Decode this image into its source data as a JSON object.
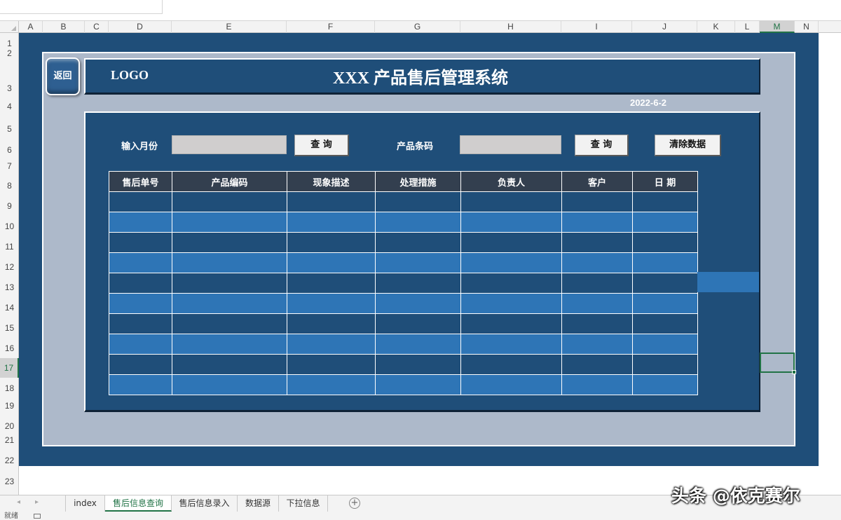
{
  "columns": [
    "A",
    "B",
    "C",
    "D",
    "E",
    "F",
    "G",
    "H",
    "I",
    "J",
    "K",
    "L",
    "M",
    "N"
  ],
  "selected_column": "M",
  "rows": [
    "1",
    "2",
    "3",
    "4",
    "5",
    "6",
    "7",
    "8",
    "9",
    "10",
    "11",
    "12",
    "13",
    "14",
    "15",
    "16",
    "17",
    "18",
    "19",
    "20",
    "21",
    "22",
    "23"
  ],
  "selected_row": "17",
  "dashboard": {
    "back_button": "返回",
    "logo": "LOGO",
    "title": "XXX 产品售后管理系统",
    "date": "2022-6-2"
  },
  "query": {
    "month_label": "输入月份",
    "month_value": "",
    "month_query_button": "查 询",
    "barcode_label": "产品条码",
    "barcode_value": "",
    "barcode_query_button": "查 询",
    "clear_button": "清除数据"
  },
  "table": {
    "headers": [
      "售后单号",
      "产品编码",
      "现象描述",
      "处理措施",
      "负责人",
      "客户",
      "日 期"
    ],
    "rows": [
      [
        "",
        "",
        "",
        "",
        "",
        "",
        ""
      ],
      [
        "",
        "",
        "",
        "",
        "",
        "",
        ""
      ],
      [
        "",
        "",
        "",
        "",
        "",
        "",
        ""
      ],
      [
        "",
        "",
        "",
        "",
        "",
        "",
        ""
      ],
      [
        "",
        "",
        "",
        "",
        "",
        "",
        ""
      ],
      [
        "",
        "",
        "",
        "",
        "",
        "",
        ""
      ],
      [
        "",
        "",
        "",
        "",
        "",
        "",
        ""
      ],
      [
        "",
        "",
        "",
        "",
        "",
        "",
        ""
      ],
      [
        "",
        "",
        "",
        "",
        "",
        "",
        ""
      ],
      [
        "",
        "",
        "",
        "",
        "",
        "",
        ""
      ]
    ]
  },
  "sheet_tabs": [
    "index",
    "售后信息查询",
    "售后信息录入",
    "数据源",
    "下拉信息"
  ],
  "active_sheet": "售后信息查询",
  "status": {
    "text": "就绪"
  },
  "watermark": "头条 @依克赛尔",
  "colors": {
    "dashboard_navy": "#1f4e79",
    "frame_gray": "#adb9ca",
    "table_header": "#333f4f",
    "row_light": "#2e75b6",
    "excel_green": "#217346"
  }
}
